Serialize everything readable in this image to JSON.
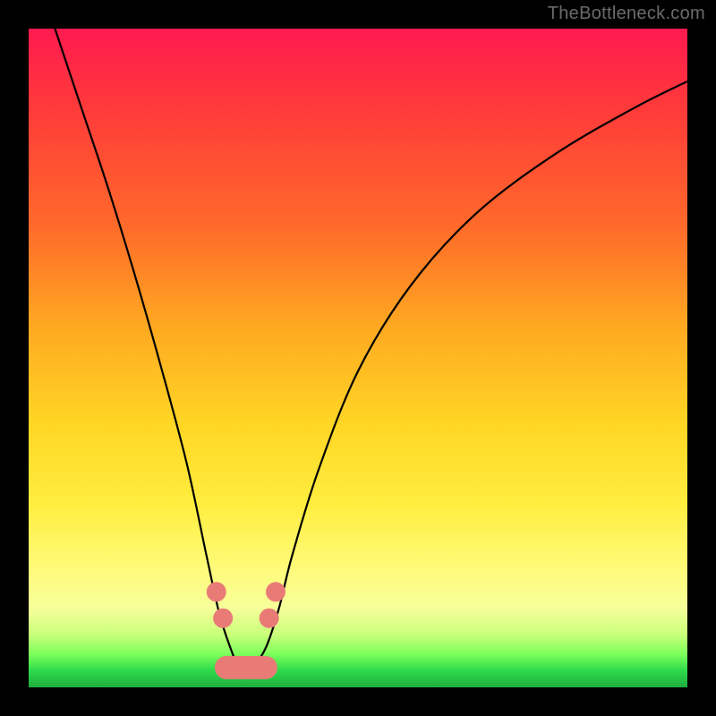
{
  "watermark": "TheBottleneck.com",
  "chart_data": {
    "type": "line",
    "title": "",
    "xlabel": "",
    "ylabel": "",
    "xlim": [
      0,
      100
    ],
    "ylim": [
      0,
      100
    ],
    "series": [
      {
        "name": "bottleneck-curve",
        "x": [
          4,
          8,
          12,
          16,
          20,
          24,
          27,
          29,
          31,
          32,
          33,
          34,
          36,
          38,
          40,
          44,
          50,
          58,
          68,
          80,
          92,
          100
        ],
        "values": [
          100,
          88,
          76,
          63,
          49,
          34,
          20,
          11,
          5,
          3,
          2.5,
          3,
          6,
          12,
          20,
          33,
          48,
          61,
          72,
          81,
          88,
          92
        ]
      }
    ],
    "annotations": [
      {
        "name": "marker-left-upper",
        "x": 28.5,
        "y": 14.5
      },
      {
        "name": "marker-left-lower",
        "x": 29.5,
        "y": 10.5
      },
      {
        "name": "marker-right-upper",
        "x": 37.5,
        "y": 14.5
      },
      {
        "name": "marker-right-lower",
        "x": 36.5,
        "y": 10.5
      }
    ],
    "bottom_band": {
      "name": "optimal-range",
      "x_start": 30,
      "x_end": 36,
      "y": 3,
      "thickness": 3.5
    }
  }
}
